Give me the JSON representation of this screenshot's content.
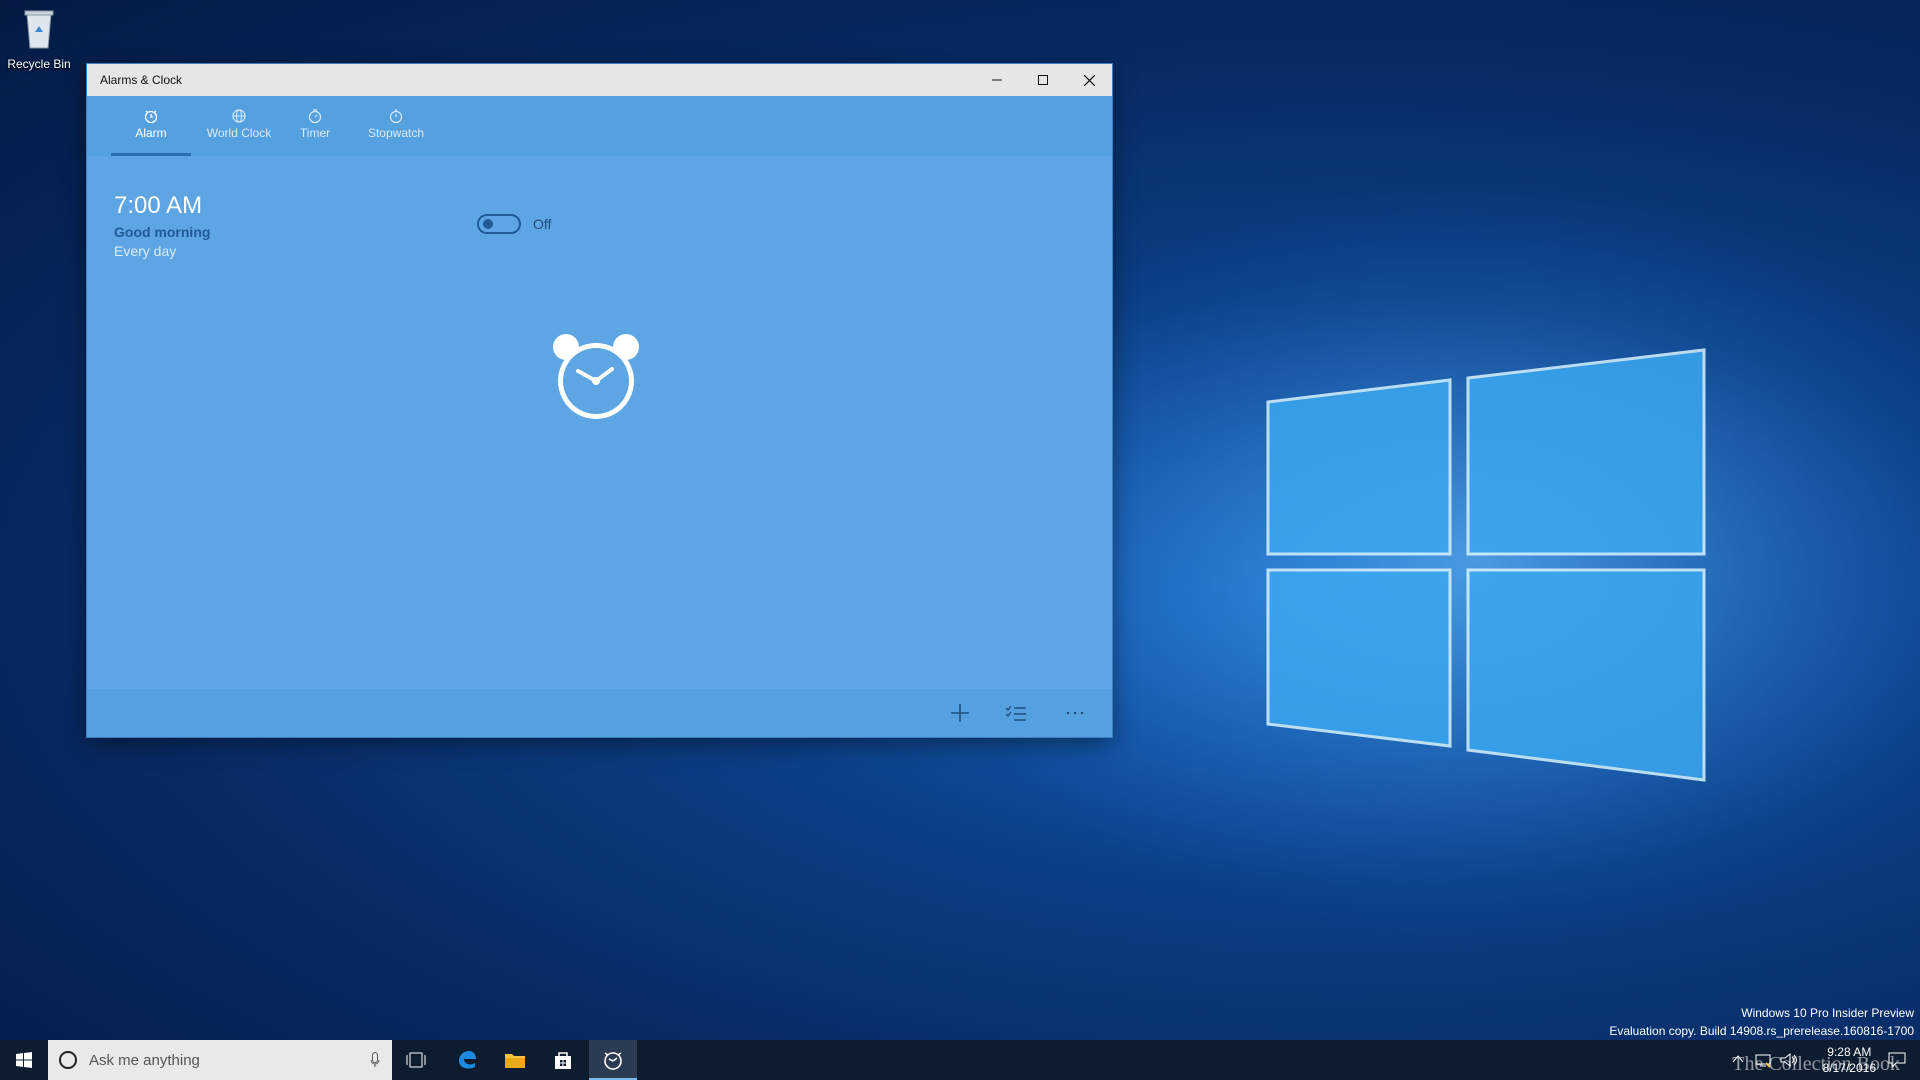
{
  "desktop": {
    "recycle_bin_label": "Recycle Bin"
  },
  "window": {
    "title": "Alarms & Clock",
    "tabs": [
      {
        "label": "Alarm",
        "icon": "alarm-icon",
        "active": true
      },
      {
        "label": "World Clock",
        "icon": "globe-icon",
        "active": false
      },
      {
        "label": "Timer",
        "icon": "timer-icon",
        "active": false
      },
      {
        "label": "Stopwatch",
        "icon": "stopwatch-icon",
        "active": false
      }
    ],
    "alarm": {
      "time": "7:00 AM",
      "name": "Good morning",
      "repeat": "Every day",
      "state": "Off"
    },
    "commands": [
      "add-icon",
      "select-list-icon",
      "more-icon"
    ]
  },
  "taskbar": {
    "search_placeholder": "Ask me anything",
    "time": "9:28 AM",
    "date": "8/17/2016"
  },
  "watermark": {
    "line1": "Windows 10 Pro Insider Preview",
    "line2": "Evaluation copy. Build 14908.rs_prerelease.160816-1700"
  },
  "brand": "The Collection Book",
  "colors": {
    "accent": "#5ea6e3",
    "taskbar": "#0e1c2f",
    "accent_dark": "#1e5b96"
  }
}
